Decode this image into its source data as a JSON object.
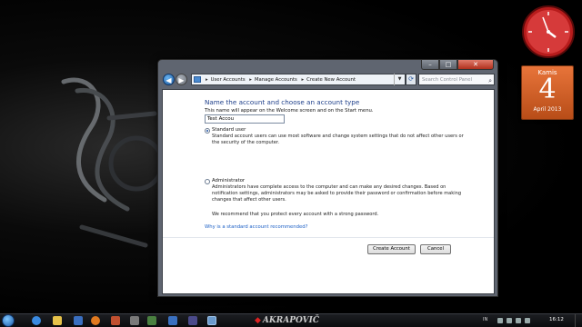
{
  "window": {
    "breadcrumb": [
      "User Accounts",
      "Manage Accounts",
      "Create New Account"
    ],
    "search_placeholder": "Search Control Panel",
    "controls": {
      "minimize": "–",
      "maximize": "□",
      "close": "✕"
    }
  },
  "page": {
    "heading": "Name the account and choose an account type",
    "subtitle": "This name will appear on the Welcome screen and on the Start menu.",
    "name_value": "Test Accou",
    "options": [
      {
        "label": "Standard user",
        "description": "Standard account users can use most software and change system settings that do not affect other users or the security of the computer.",
        "selected": true
      },
      {
        "label": "Administrator",
        "description": "Administrators have complete access to the computer and can make any desired changes. Based on notification settings, administrators may be asked to provide their password or confirmation before making changes that affect other users.",
        "selected": false
      }
    ],
    "recommendation": "We recommend that you protect every account with a strong password.",
    "link": "Why is a standard account recommended?",
    "buttons": {
      "create": "Create Account",
      "cancel": "Cancel"
    }
  },
  "gadgets": {
    "calendar": {
      "weekday": "Kamis",
      "day": "4",
      "month_year": "April 2013"
    }
  },
  "taskbar": {
    "brand": "AKRAPOVIČ",
    "language": "IN",
    "time": "16:12"
  },
  "colors": {
    "heading": "#1e3f8a",
    "link": "#1a5ec5",
    "calendar": "#d8642a",
    "brand_mark": "#dd2222"
  },
  "icons": [
    "back-arrow-icon",
    "forward-arrow-icon",
    "control-panel-icon",
    "refresh-icon",
    "search-icon",
    "windows-start-icon",
    "clock-icon"
  ]
}
